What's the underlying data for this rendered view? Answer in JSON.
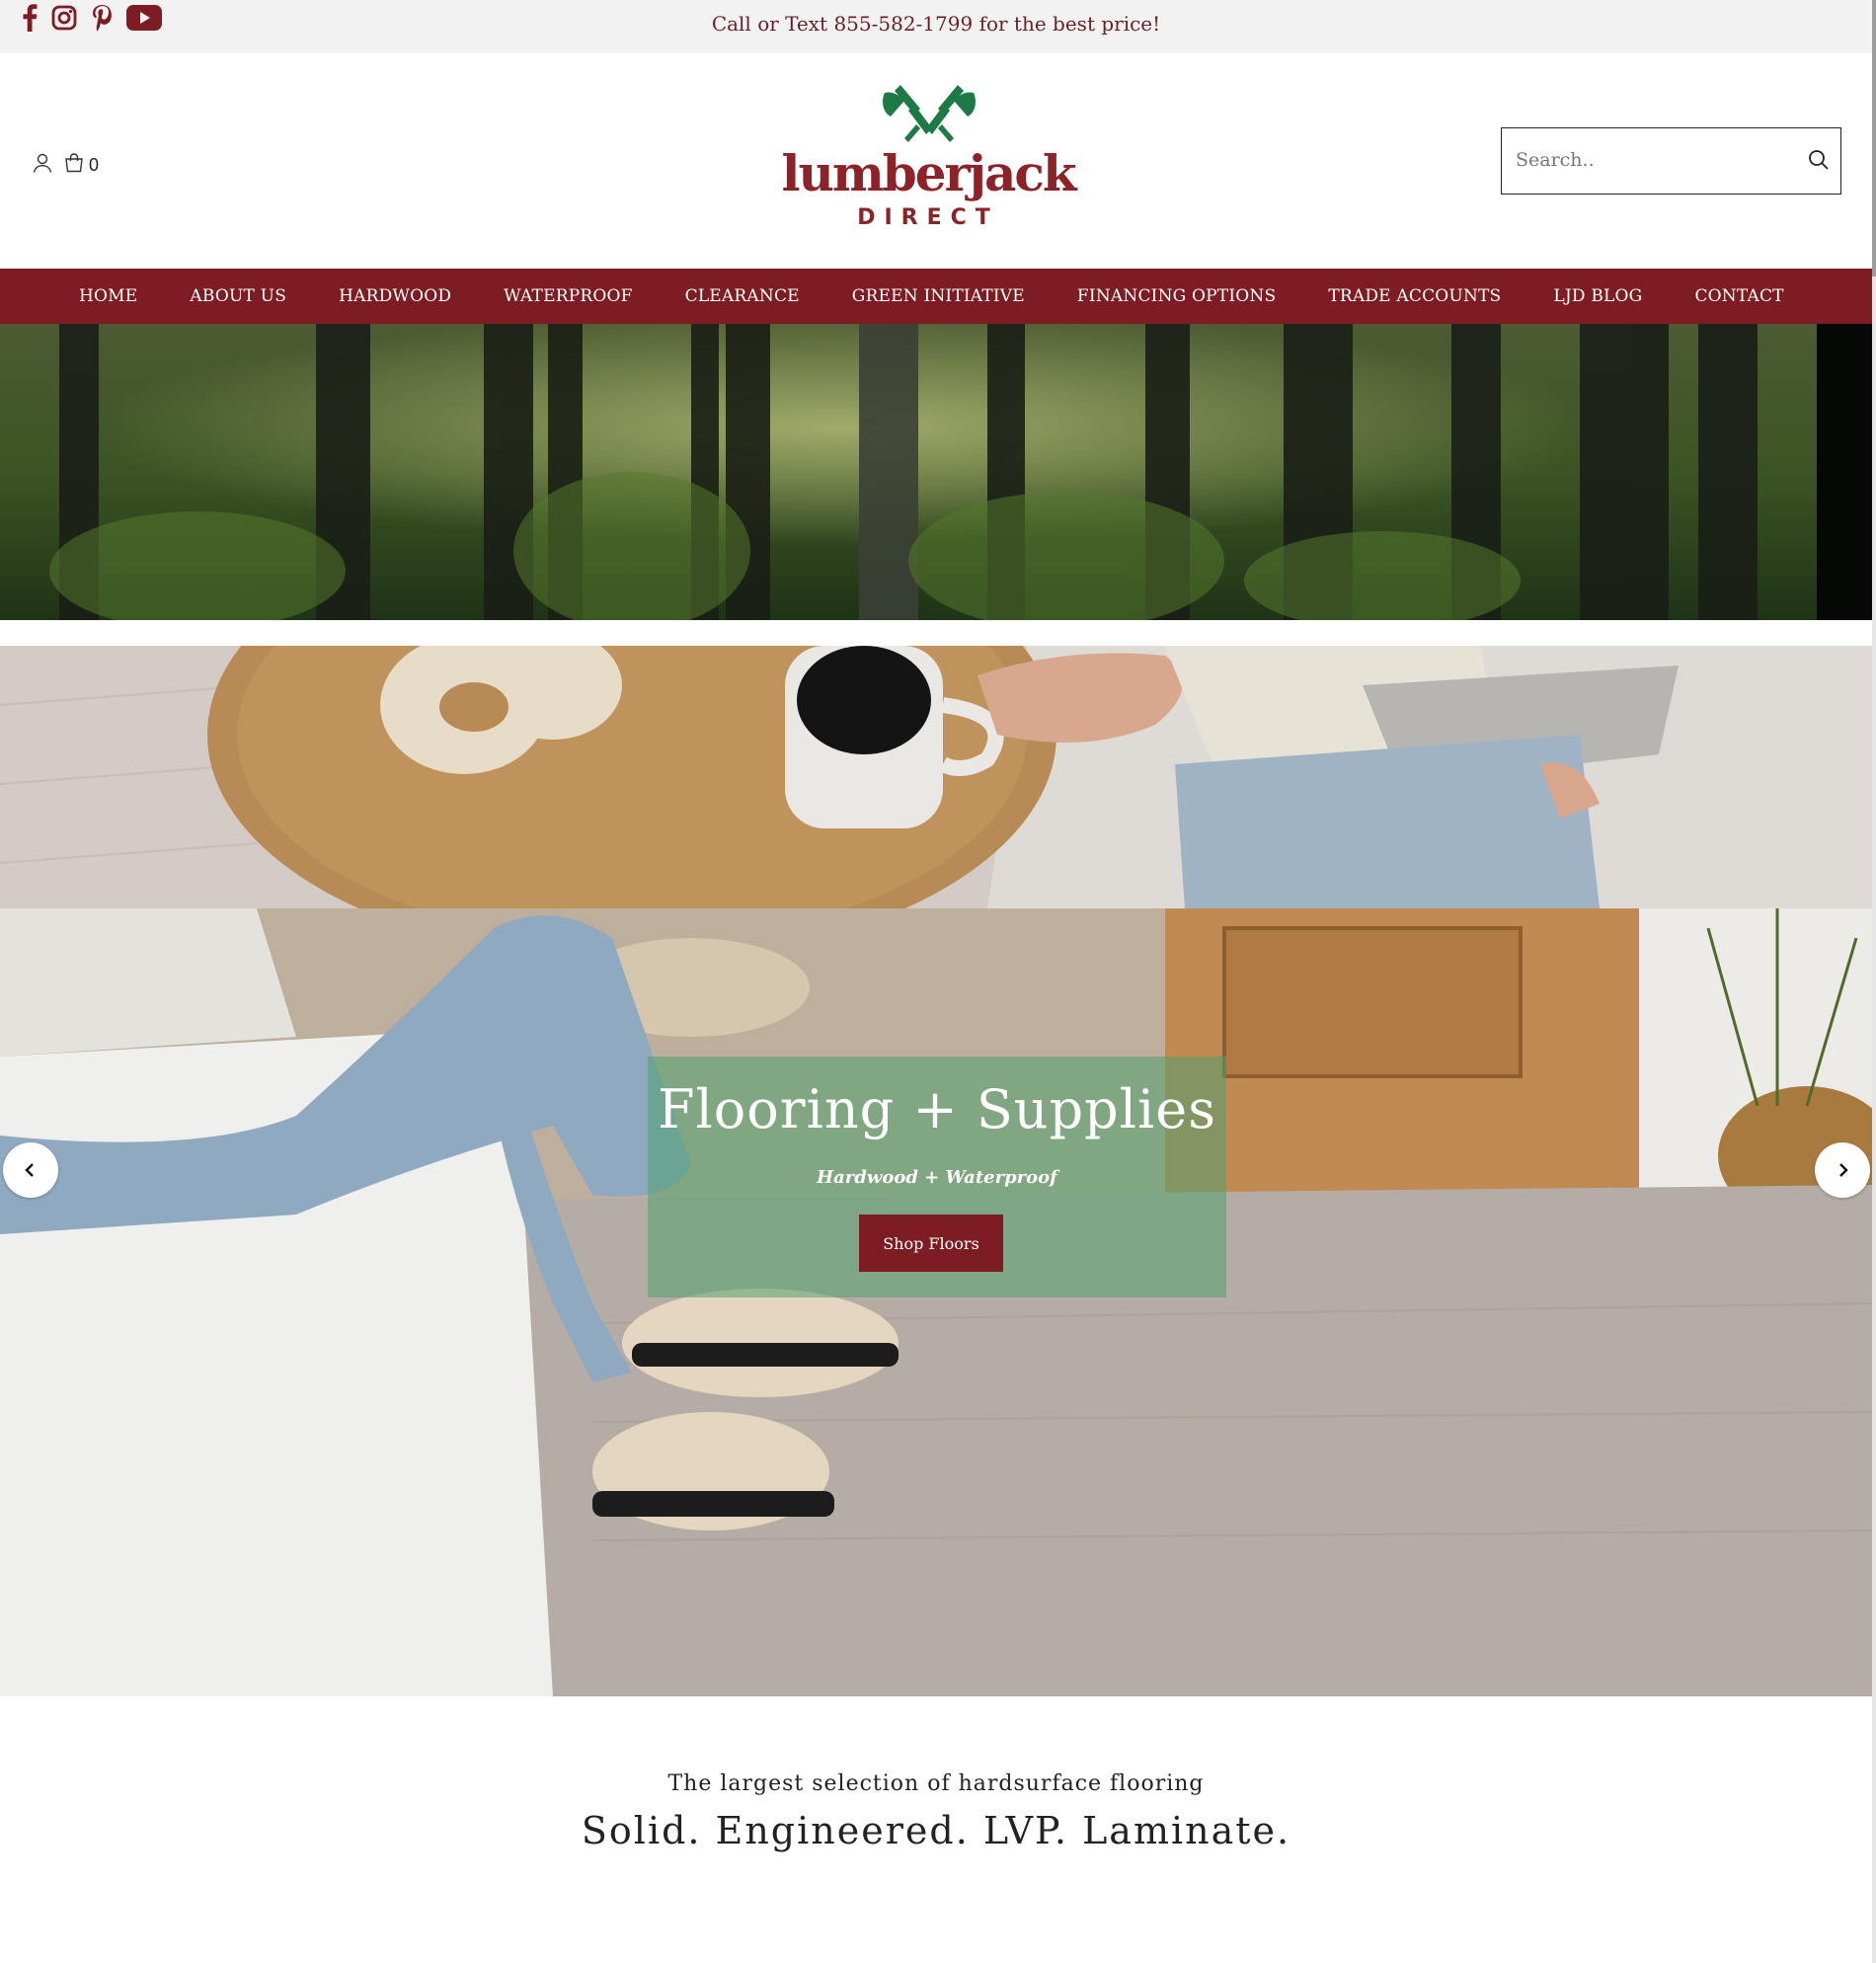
{
  "topbar": {
    "announcement": "Call or Text 855-582-1799 for the best price!",
    "social": [
      "facebook-icon",
      "instagram-icon",
      "pinterest-icon",
      "youtube-icon"
    ],
    "social_color": "#7d1d23"
  },
  "header": {
    "logo_word": "lumberjack",
    "logo_sub": "DIRECT",
    "cart_count": "0",
    "search_placeholder": "Search..",
    "brand_red": "#8b2328",
    "brand_green": "#1e7a45"
  },
  "nav": {
    "items": [
      "HOME",
      "ABOUT US",
      "HARDWOOD",
      "WATERPROOF",
      "CLEARANCE",
      "GREEN INITIATIVE",
      "FINANCING OPTIONS",
      "TRADE ACCOUNTS",
      "LJD BLOG",
      "CONTACT"
    ],
    "background": "#7d1d23"
  },
  "hero": {
    "title": "Flooring + Supplies",
    "subtitle": "Hardwood + Waterproof",
    "button": "Shop Floors"
  },
  "intro": {
    "tagline": "The largest selection of hardsurface flooring",
    "headline": "Solid. Engineered. LVP. Laminate."
  }
}
